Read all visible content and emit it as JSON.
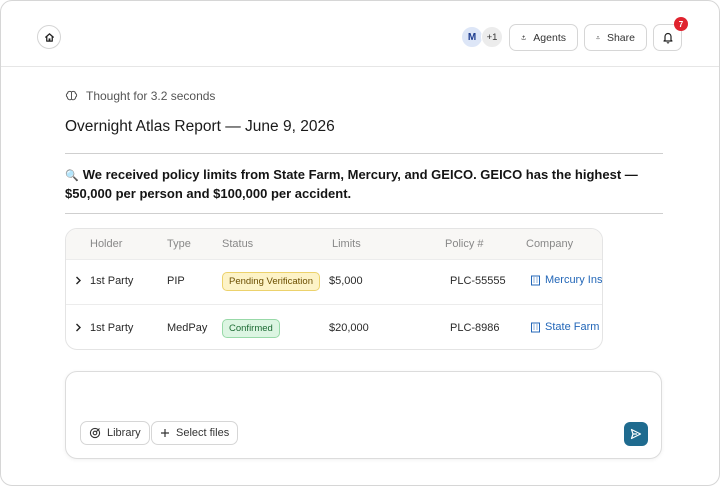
{
  "header": {
    "avatars": [
      {
        "initial": "M"
      }
    ],
    "avatars_more": "+1",
    "agents_label": "Agents",
    "share_label": "Share",
    "notifications_count": "7"
  },
  "main": {
    "thought": "Thought for 3.2 seconds",
    "report_title": "Overnight Atlas Report — June 9, 2026",
    "summary_icon": "🔍",
    "summary": "We received policy limits from State Farm, Mercury, and GEICO. GEICO has the highest — $50,000 per person and $100,000 per accident."
  },
  "table": {
    "columns": [
      "Holder",
      "Type",
      "Status",
      "Limits",
      "Policy #",
      "Company"
    ],
    "rows": [
      {
        "holder": "1st Party",
        "type": "PIP",
        "status": "Pending Verification",
        "status_kind": "pending",
        "limits": "$5,000",
        "policy": "PLC-55555",
        "company": "Mercury Insurance"
      },
      {
        "holder": "1st Party",
        "type": "MedPay",
        "status": "Confirmed",
        "status_kind": "confirmed",
        "limits": "$20,000",
        "policy": "PLC-8986",
        "company": "State Farm"
      }
    ]
  },
  "composer": {
    "library_label": "Library",
    "select_files_label": "Select files"
  },
  "colors": {
    "badge": "#e0232e",
    "link": "#2367b8",
    "send": "#1f6b8f",
    "pending_bg": "#fdf3c7",
    "confirmed_bg": "#dcf5e2"
  }
}
